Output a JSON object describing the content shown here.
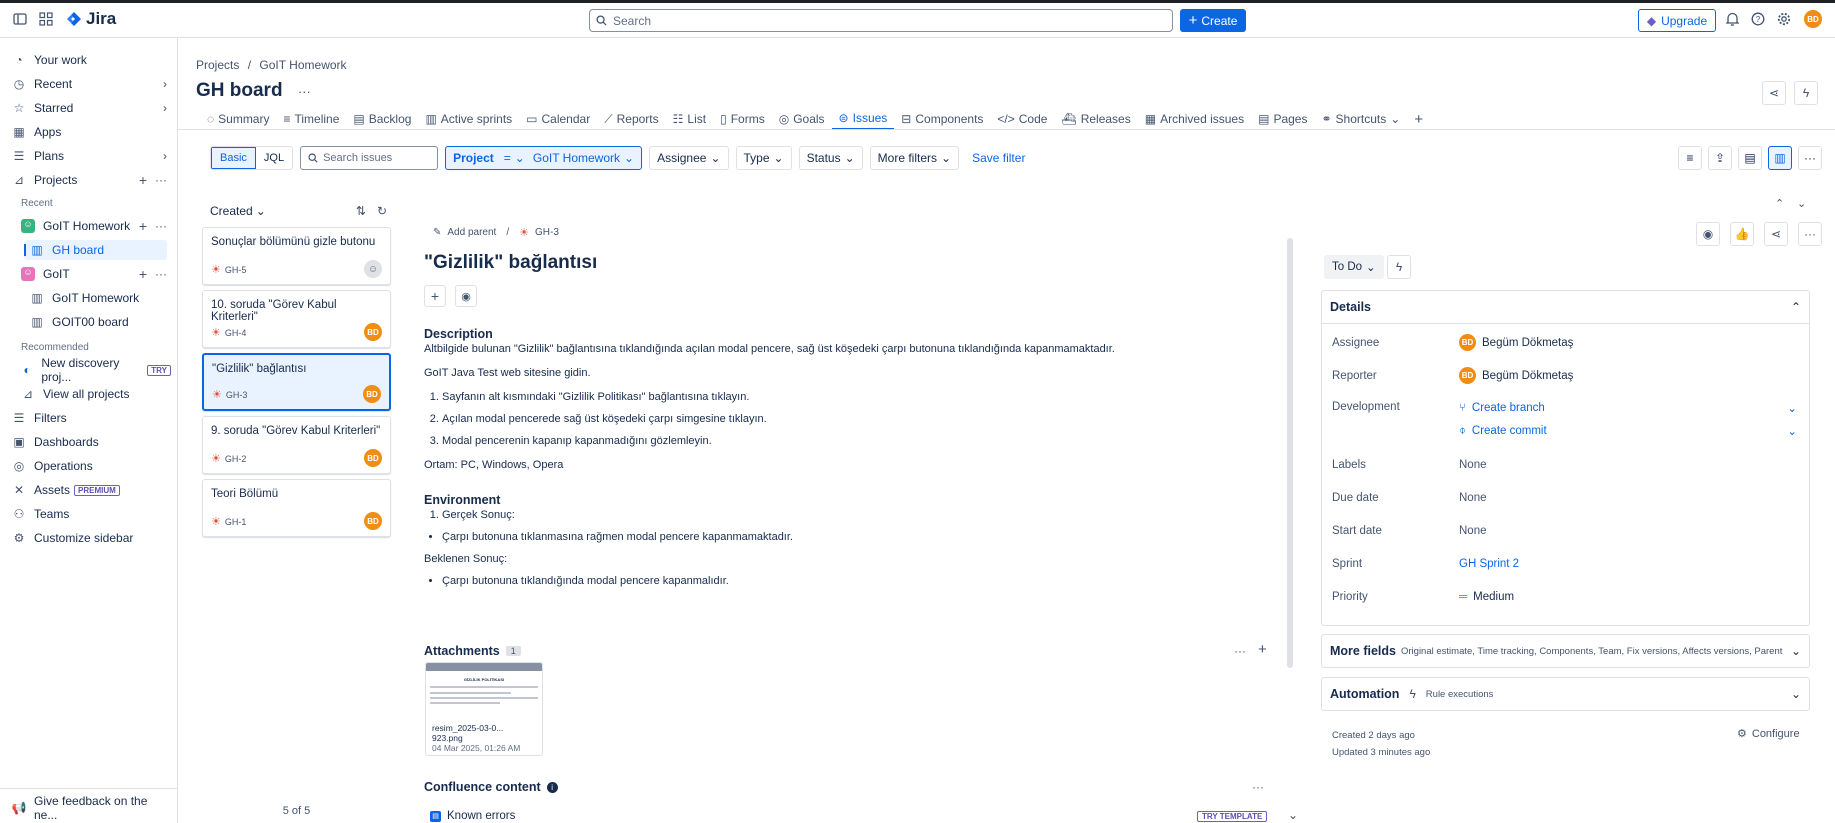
{
  "top": {
    "logo": "Jira",
    "search_placeholder": "Search",
    "create": "Create",
    "upgrade": "Upgrade",
    "avatar": "BD"
  },
  "sidebar": {
    "your_work": "Your work",
    "recent": "Recent",
    "starred": "Starred",
    "apps": "Apps",
    "plans": "Plans",
    "projects": "Projects",
    "recent_header": "Recent",
    "proj1": "GoIT Homework",
    "board1": "GH board",
    "proj2": "GoIT",
    "sub1": "GoIT Homework",
    "sub2": "GOIT00 board",
    "recommended": "Recommended",
    "discovery": "New discovery proj...",
    "try": "TRY",
    "view_all": "View all projects",
    "filters": "Filters",
    "dashboards": "Dashboards",
    "operations": "Operations",
    "assets": "Assets",
    "premium": "PREMIUM",
    "teams": "Teams",
    "customize": "Customize sidebar",
    "feedback": "Give feedback on the ne..."
  },
  "header": {
    "crumb1": "Projects",
    "crumb_sep": "/",
    "crumb2": "GoIT Homework",
    "title": "GH board",
    "more": "···"
  },
  "tabs": [
    "Summary",
    "Timeline",
    "Backlog",
    "Active sprints",
    "Calendar",
    "Reports",
    "List",
    "Forms",
    "Goals",
    "Issues",
    "Components",
    "Code",
    "Releases",
    "Archived issues",
    "Pages",
    "Shortcuts"
  ],
  "filters": {
    "basic": "Basic",
    "jql": "JQL",
    "search_placeholder": "Search issues",
    "project_label": "Project",
    "project_eq": "=",
    "project_value": "GoIT Homework",
    "assignee": "Assignee",
    "type": "Type",
    "status": "Status",
    "more": "More filters",
    "save": "Save filter"
  },
  "list": {
    "sort": "Created",
    "count": "5 of 5",
    "issues": [
      {
        "title": "Sonuçlar bölümünü gizle butonu",
        "key": "GH-5",
        "assigned": false
      },
      {
        "title": "10. soruda \"Görev Kabul Kriterleri\"",
        "key": "GH-4",
        "assigned": true
      },
      {
        "title": "\"Gizlilik\" bağlantısı",
        "key": "GH-3",
        "assigned": true
      },
      {
        "title": "9. soruda \"Görev Kabul Kriterleri\"",
        "key": "GH-2",
        "assigned": true
      },
      {
        "title": "Teori Bölümü",
        "key": "GH-1",
        "assigned": true
      }
    ]
  },
  "issue": {
    "add_parent": "Add parent",
    "key": "GH-3",
    "title": "\"Gizlilik\" bağlantısı",
    "description_h": "Description",
    "desc1": "Altbilgide bulunan \"Gizlilik\" bağlantısına tıklandığında açılan modal pencere, sağ üst köşedeki çarpı butonuna tıklandığında kapanmamaktadır.",
    "desc2": "GoIT Java Test web sitesine gidin.",
    "steps": [
      "Sayfanın alt kısmındaki \"Gizlilik Politikası\" bağlantısına tıklayın.",
      "Açılan modal pencerede sağ üst köşedeki çarpı simgesine tıklayın.",
      "Modal pencerenin kapanıp kapanmadığını gözlemleyin."
    ],
    "desc3": "Ortam: PC, Windows, Opera",
    "environment_h": "Environment",
    "env1": "Gerçek Sonuç:",
    "env2": "Çarpı butonuna tıklanmasına rağmen modal pencere kapanmamaktadır.",
    "env3": "Beklenen Sonuç:",
    "env4": "Çarpı butonuna tıklandığında modal pencere kapanmalıdır.",
    "attachments_h": "Attachments",
    "attach_count": "1",
    "file_name": "resim_2025-03-0... 923.png",
    "file_date": "04 Mar 2025, 01:26 AM",
    "file_preview_title": "GİZLİLİK POLİTİKASI",
    "confluence_h": "Confluence content",
    "known_errors": "Known errors",
    "try_template": "TRY TEMPLATE"
  },
  "details": {
    "status": "To Do",
    "header": "Details",
    "assignee_l": "Assignee",
    "assignee": "Begüm Dökmetaş",
    "reporter_l": "Reporter",
    "reporter": "Begüm Dökmetaş",
    "development_l": "Development",
    "branch": "Create branch",
    "commit": "Create commit",
    "labels_l": "Labels",
    "labels": "None",
    "due_l": "Due date",
    "due": "None",
    "start_l": "Start date",
    "start": "None",
    "sprint_l": "Sprint",
    "sprint": "GH Sprint 2",
    "priority_l": "Priority",
    "priority": "Medium",
    "more_fields": "More fields",
    "more_fields_sub": "Original estimate, Time tracking, Components, Team, Fix versions, Affects versions, Parent",
    "automation": "Automation",
    "rule_exec": "Rule executions",
    "created": "Created 2 days ago",
    "updated": "Updated 3 minutes ago",
    "configure": "Configure"
  }
}
